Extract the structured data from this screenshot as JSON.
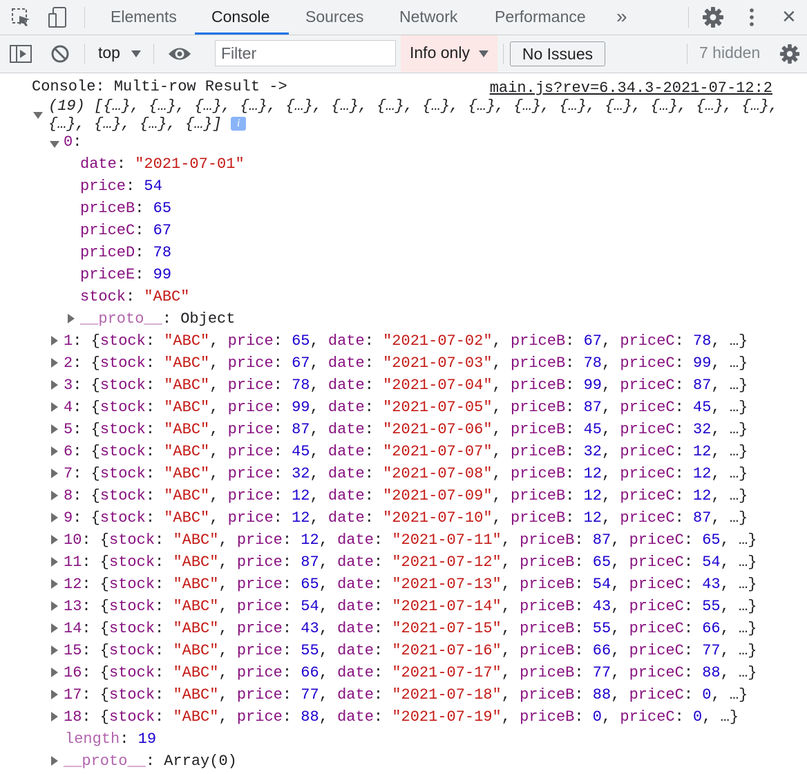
{
  "toolbar": {
    "tabs": [
      "Elements",
      "Console",
      "Sources",
      "Network",
      "Performance"
    ],
    "more_tabs": "»",
    "close": "✕"
  },
  "filterbar": {
    "context": "top",
    "filter_placeholder": "Filter",
    "levels": "Info only",
    "issues": "No Issues",
    "hidden": "7 hidden"
  },
  "console": {
    "message": "Console: Multi-row Result ->",
    "source": "main.js?rev=6.34.3-2021-07-12:2",
    "summary_line1": "(19) [{…}, {…}, {…}, {…}, {…}, {…}, {…}, {…}, {…}, {…}, {…}, {…}, {…}, {…}, {…},",
    "summary_line2": "{…}, {…}, {…}, {…}]",
    "expanded_index": "0",
    "expanded_props": [
      {
        "key": "date",
        "value": "\"2021-07-01\"",
        "type": "str"
      },
      {
        "key": "price",
        "value": "54",
        "type": "num"
      },
      {
        "key": "priceB",
        "value": "65",
        "type": "num"
      },
      {
        "key": "priceC",
        "value": "67",
        "type": "num"
      },
      {
        "key": "priceD",
        "value": "78",
        "type": "num"
      },
      {
        "key": "priceE",
        "value": "99",
        "type": "num"
      },
      {
        "key": "stock",
        "value": "\"ABC\"",
        "type": "str"
      }
    ],
    "expanded_proto_key": "__proto__",
    "expanded_proto_value": "Object",
    "rows": [
      {
        "index": "1",
        "stock": "\"ABC\"",
        "price": "65",
        "date": "\"2021-07-02\"",
        "priceB": "67",
        "priceC": "78"
      },
      {
        "index": "2",
        "stock": "\"ABC\"",
        "price": "67",
        "date": "\"2021-07-03\"",
        "priceB": "78",
        "priceC": "99"
      },
      {
        "index": "3",
        "stock": "\"ABC\"",
        "price": "78",
        "date": "\"2021-07-04\"",
        "priceB": "99",
        "priceC": "87"
      },
      {
        "index": "4",
        "stock": "\"ABC\"",
        "price": "99",
        "date": "\"2021-07-05\"",
        "priceB": "87",
        "priceC": "45"
      },
      {
        "index": "5",
        "stock": "\"ABC\"",
        "price": "87",
        "date": "\"2021-07-06\"",
        "priceB": "45",
        "priceC": "32"
      },
      {
        "index": "6",
        "stock": "\"ABC\"",
        "price": "45",
        "date": "\"2021-07-07\"",
        "priceB": "32",
        "priceC": "12"
      },
      {
        "index": "7",
        "stock": "\"ABC\"",
        "price": "32",
        "date": "\"2021-07-08\"",
        "priceB": "12",
        "priceC": "12"
      },
      {
        "index": "8",
        "stock": "\"ABC\"",
        "price": "12",
        "date": "\"2021-07-09\"",
        "priceB": "12",
        "priceC": "12"
      },
      {
        "index": "9",
        "stock": "\"ABC\"",
        "price": "12",
        "date": "\"2021-07-10\"",
        "priceB": "12",
        "priceC": "87"
      },
      {
        "index": "10",
        "stock": "\"ABC\"",
        "price": "12",
        "date": "\"2021-07-11\"",
        "priceB": "87",
        "priceC": "65"
      },
      {
        "index": "11",
        "stock": "\"ABC\"",
        "price": "87",
        "date": "\"2021-07-12\"",
        "priceB": "65",
        "priceC": "54"
      },
      {
        "index": "12",
        "stock": "\"ABC\"",
        "price": "65",
        "date": "\"2021-07-13\"",
        "priceB": "54",
        "priceC": "43"
      },
      {
        "index": "13",
        "stock": "\"ABC\"",
        "price": "54",
        "date": "\"2021-07-14\"",
        "priceB": "43",
        "priceC": "55"
      },
      {
        "index": "14",
        "stock": "\"ABC\"",
        "price": "43",
        "date": "\"2021-07-15\"",
        "priceB": "55",
        "priceC": "66"
      },
      {
        "index": "15",
        "stock": "\"ABC\"",
        "price": "55",
        "date": "\"2021-07-16\"",
        "priceB": "66",
        "priceC": "77"
      },
      {
        "index": "16",
        "stock": "\"ABC\"",
        "price": "66",
        "date": "\"2021-07-17\"",
        "priceB": "77",
        "priceC": "88"
      },
      {
        "index": "17",
        "stock": "\"ABC\"",
        "price": "77",
        "date": "\"2021-07-18\"",
        "priceB": "88",
        "priceC": "0"
      },
      {
        "index": "18",
        "stock": "\"ABC\"",
        "price": "88",
        "date": "\"2021-07-19\"",
        "priceB": "0",
        "priceC": "0"
      }
    ],
    "length_key": "length",
    "length_value": "19",
    "array_proto_key": "__proto__",
    "array_proto_value": "Array(0)"
  }
}
